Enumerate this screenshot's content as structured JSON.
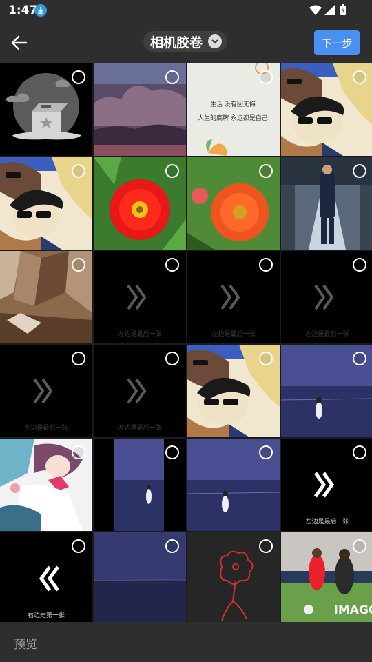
{
  "status_bar": {
    "time": "1:47"
  },
  "header": {
    "title": "相机胶卷",
    "next_label": "下一步"
  },
  "grid": {
    "items": [
      {
        "kind": "placeholder"
      },
      {
        "kind": "clouds"
      },
      {
        "kind": "note",
        "text1": "生活 没有回无悔",
        "text2": "人生的底牌 永远都是自己"
      },
      {
        "kind": "anime"
      },
      {
        "kind": "anime"
      },
      {
        "kind": "red-flower"
      },
      {
        "kind": "orange-flower"
      },
      {
        "kind": "runway"
      },
      {
        "kind": "rock"
      },
      {
        "kind": "swipe-dim",
        "caption": "左边是最后一张"
      },
      {
        "kind": "swipe-dim",
        "caption": "左边是最后一张"
      },
      {
        "kind": "swipe-dim",
        "caption": "左边是最后一张"
      },
      {
        "kind": "swipe-dim",
        "caption": "左边是最后一张"
      },
      {
        "kind": "swipe-dim",
        "caption": "左边是最后一张"
      },
      {
        "kind": "anime"
      },
      {
        "kind": "sea"
      },
      {
        "kind": "schoolgirl"
      },
      {
        "kind": "sea-narrow"
      },
      {
        "kind": "sea"
      },
      {
        "kind": "swipe-right",
        "caption": "左边是最后一张"
      },
      {
        "kind": "swipe-left",
        "caption": "右边是第一张"
      },
      {
        "kind": "sea-dark"
      },
      {
        "kind": "chalk"
      },
      {
        "kind": "soccer",
        "watermark": "IMAGO."
      }
    ]
  },
  "footer": {
    "preview_label": "预览"
  },
  "colors": {
    "accent": "#4a90f0",
    "bar": "#2e2e2e"
  }
}
